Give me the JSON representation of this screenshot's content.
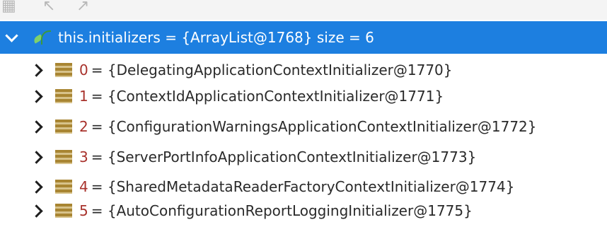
{
  "toolbar": {
    "icons": [
      "grid-icon",
      "back-arrow-icon",
      "forward-arrow-icon"
    ]
  },
  "tree": {
    "root": {
      "label": "this.initializers = {ArrayList@1768}  size = 6"
    },
    "items": [
      {
        "index": "0",
        "value": "= {DelegatingApplicationContextInitializer@1770}"
      },
      {
        "index": "1",
        "value": "= {ContextIdApplicationContextInitializer@1771}"
      },
      {
        "index": "2",
        "value": "= {ConfigurationWarningsApplicationContextInitializer@1772}"
      },
      {
        "index": "3",
        "value": "= {ServerPortInfoApplicationContextInitializer@1773}"
      },
      {
        "index": "4",
        "value": "= {SharedMetadataReaderFactoryContextInitializer@1774}"
      },
      {
        "index": "5",
        "value": "= {AutoConfigurationReportLoggingInitializer@1775}"
      }
    ]
  },
  "colors": {
    "selection": "#1d7fe0",
    "index": "#a8322c",
    "text": "#2a2a2a",
    "array_icon": "#a88532"
  }
}
